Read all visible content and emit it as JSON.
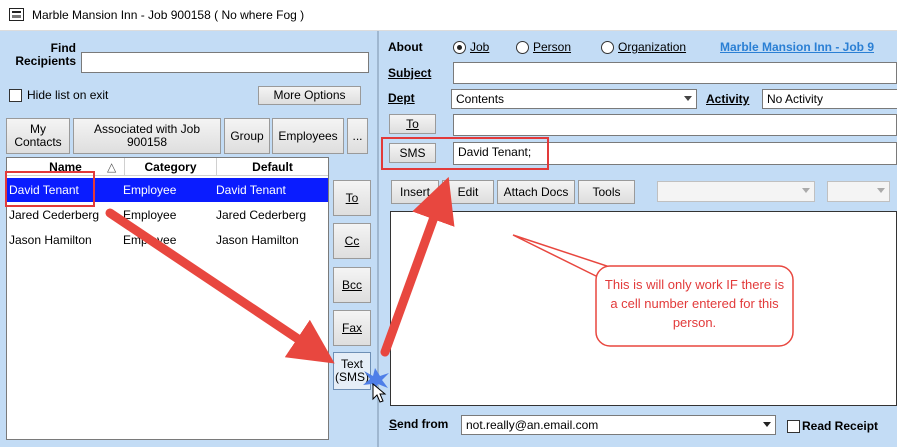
{
  "window": {
    "title": "Marble Mansion Inn - Job 900158 ( No where Fog )"
  },
  "left": {
    "find_label": "Find Recipients",
    "find_value": "",
    "hide_list_label": "Hide list on exit",
    "more_options_label": "More Options",
    "tabs": [
      "My Contacts",
      "Associated with Job 900158",
      "Group",
      "Employees",
      "..."
    ],
    "columns": [
      "Name",
      "Category",
      "Default"
    ],
    "rows": [
      {
        "name": "David Tenant",
        "category": "Employee",
        "default": "David Tenant"
      },
      {
        "name": "Jared Cederberg",
        "category": "Employee",
        "default": "Jared Cederberg"
      },
      {
        "name": "Jason Hamilton",
        "category": "Employee",
        "default": "Jason Hamilton"
      }
    ],
    "add_buttons": {
      "to": "To",
      "cc": "Cc",
      "bcc": "Bcc",
      "fax": "Fax",
      "text_sms": "Text (SMS)"
    }
  },
  "right": {
    "about_label": "About",
    "radios": {
      "job": "Job",
      "person": "Person",
      "organization": "Organization",
      "selected": "Job"
    },
    "about_link": "Marble Mansion Inn - Job 9",
    "subject_label": "Subject",
    "subject_value": "",
    "dept_label": "Dept",
    "dept_value": "Contents",
    "activity_label": "Activity",
    "activity_value": "No Activity",
    "to_button": "To",
    "to_value": "",
    "sms_button": "SMS",
    "sms_value": "David Tenant;",
    "toolbar": {
      "insert": "Insert",
      "edit": "Edit",
      "attach_docs": "Attach Docs",
      "tools": "Tools"
    },
    "annotation": "This is will only work IF there is a cell number entered for this person.",
    "send_from_label": "Send from",
    "send_from_value": "not.really@an.email.com",
    "read_receipt_label": "Read Receipt"
  },
  "colors": {
    "annotation_red": "#e8473f",
    "selection_blue": "#0a1cff",
    "pane_blue": "#c3dcf5"
  }
}
